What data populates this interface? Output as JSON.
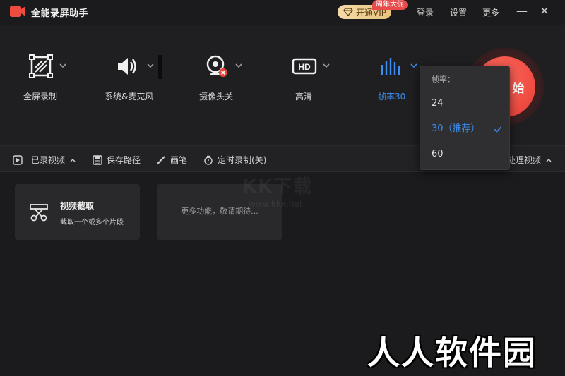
{
  "app": {
    "title": "全能录屏助手"
  },
  "header": {
    "vip_label": "开通VIP",
    "vip_badge": "周年大促",
    "login": "登录",
    "settings": "设置",
    "more": "更多",
    "minimize": "—",
    "close": "✕"
  },
  "toolbar": {
    "fullscreen": "全屏录制",
    "audio": "系统&麦克风",
    "camera": "摄像头关",
    "quality": "高清",
    "framerate": "帧率30",
    "record": "始"
  },
  "framerate_menu": {
    "title": "帧率：",
    "options": [
      "24",
      "30（推荐）",
      "60"
    ],
    "selected_index": 1
  },
  "subbar": {
    "recorded": "已录视频",
    "save_path": "保存路径",
    "brush": "画笔",
    "timer": "定时录制(关)",
    "process": "处理视频"
  },
  "cards": {
    "clip_title": "视频截取",
    "clip_sub": "截取一个或多个片段",
    "more_text": "更多功能，敬请期待..."
  },
  "watermarks": {
    "kk_text": "KK下载",
    "kk_url": "www.kkx.net",
    "brand": "人人软件园"
  },
  "colors": {
    "accent": "#3b8ef0",
    "record": "#e83c33",
    "vip_gold": "#e9c27d"
  }
}
